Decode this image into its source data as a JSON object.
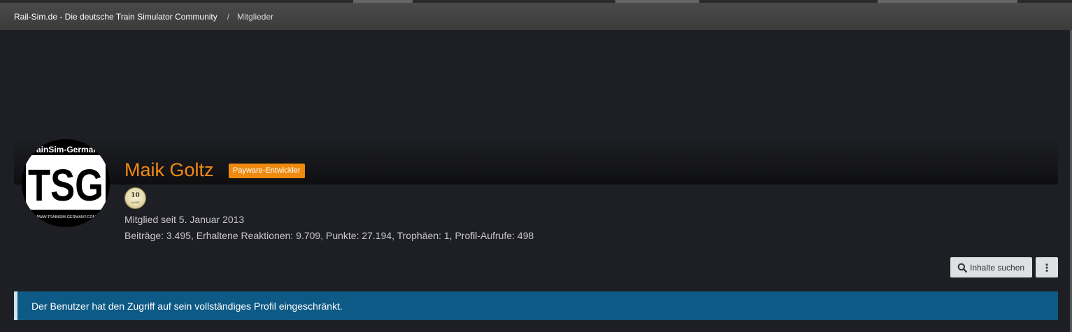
{
  "breadcrumb": {
    "items": [
      "Rail-Sim.de - Die deutsche Train Simulator Community",
      "Mitglieder"
    ],
    "separator": "/"
  },
  "avatar": {
    "logo_text": "TSG",
    "top_text": "TrainSim-Germany",
    "bottom_text": "WWW.TRAINSIM-GERMANY.COM"
  },
  "profile": {
    "name": "Maik Goltz",
    "badge": "Payware-Entwickler",
    "trophy_number": "10",
    "trophy_sub": "JAHRE",
    "member_since": "Mitglied seit 5. Januar 2013",
    "stats": "Beiträge: 3.495, Erhaltene Reaktionen: 9.709, Punkte: 27.194, Trophäen: 1, Profil-Aufrufe: 498"
  },
  "actions": {
    "search_label": "Inhalte suchen",
    "more_icon": "ellipsis-vertical-icon"
  },
  "notice": {
    "text": "Der Benutzer hat den Zugriff auf sein vollständiges Profil eingeschränkt."
  },
  "colors": {
    "name": "#f48a12",
    "badge": "#ef8a0e",
    "notice_bg": "#0e5a86",
    "page_bg": "#1e1f24"
  }
}
